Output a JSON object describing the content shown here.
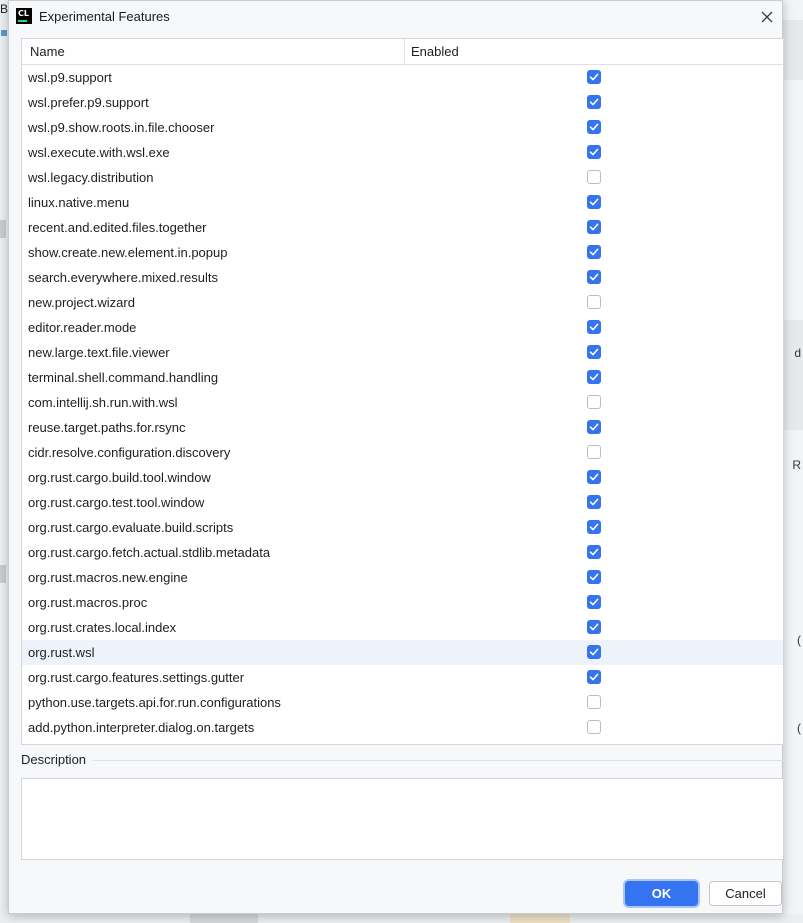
{
  "window": {
    "title": "Experimental Features",
    "app_icon_text": "CL"
  },
  "table": {
    "columns": [
      "Name",
      "Enabled"
    ],
    "rows": [
      {
        "name": "wsl.p9.support",
        "enabled": true
      },
      {
        "name": "wsl.prefer.p9.support",
        "enabled": true
      },
      {
        "name": "wsl.p9.show.roots.in.file.chooser",
        "enabled": true
      },
      {
        "name": "wsl.execute.with.wsl.exe",
        "enabled": true
      },
      {
        "name": "wsl.legacy.distribution",
        "enabled": false
      },
      {
        "name": "linux.native.menu",
        "enabled": true
      },
      {
        "name": "recent.and.edited.files.together",
        "enabled": true
      },
      {
        "name": "show.create.new.element.in.popup",
        "enabled": true
      },
      {
        "name": "search.everywhere.mixed.results",
        "enabled": true
      },
      {
        "name": "new.project.wizard",
        "enabled": false
      },
      {
        "name": "editor.reader.mode",
        "enabled": true
      },
      {
        "name": "new.large.text.file.viewer",
        "enabled": true
      },
      {
        "name": "terminal.shell.command.handling",
        "enabled": true
      },
      {
        "name": "com.intellij.sh.run.with.wsl",
        "enabled": false
      },
      {
        "name": "reuse.target.paths.for.rsync",
        "enabled": true
      },
      {
        "name": "cidr.resolve.configuration.discovery",
        "enabled": false
      },
      {
        "name": "org.rust.cargo.build.tool.window",
        "enabled": true
      },
      {
        "name": "org.rust.cargo.test.tool.window",
        "enabled": true
      },
      {
        "name": "org.rust.cargo.evaluate.build.scripts",
        "enabled": true
      },
      {
        "name": "org.rust.cargo.fetch.actual.stdlib.metadata",
        "enabled": true
      },
      {
        "name": "org.rust.macros.new.engine",
        "enabled": true
      },
      {
        "name": "org.rust.macros.proc",
        "enabled": true
      },
      {
        "name": "org.rust.crates.local.index",
        "enabled": true
      },
      {
        "name": "org.rust.wsl",
        "enabled": true,
        "selected": true
      },
      {
        "name": "org.rust.cargo.features.settings.gutter",
        "enabled": true
      },
      {
        "name": "python.use.targets.api.for.run.configurations",
        "enabled": false
      },
      {
        "name": "add.python.interpreter.dialog.on.targets",
        "enabled": false
      }
    ]
  },
  "description": {
    "label": "Description",
    "text": ""
  },
  "buttons": {
    "ok_label": "OK",
    "cancel_label": "Cancel"
  },
  "colors": {
    "accent": "#3574f0",
    "selected_row": "#edf2fb"
  },
  "icons": {
    "app": "clion-app-icon",
    "close": "close-icon",
    "check": "checkmark-icon"
  },
  "background": {
    "top_left_letter": "B",
    "right_marks": [
      "d",
      "R",
      "(",
      "("
    ]
  }
}
